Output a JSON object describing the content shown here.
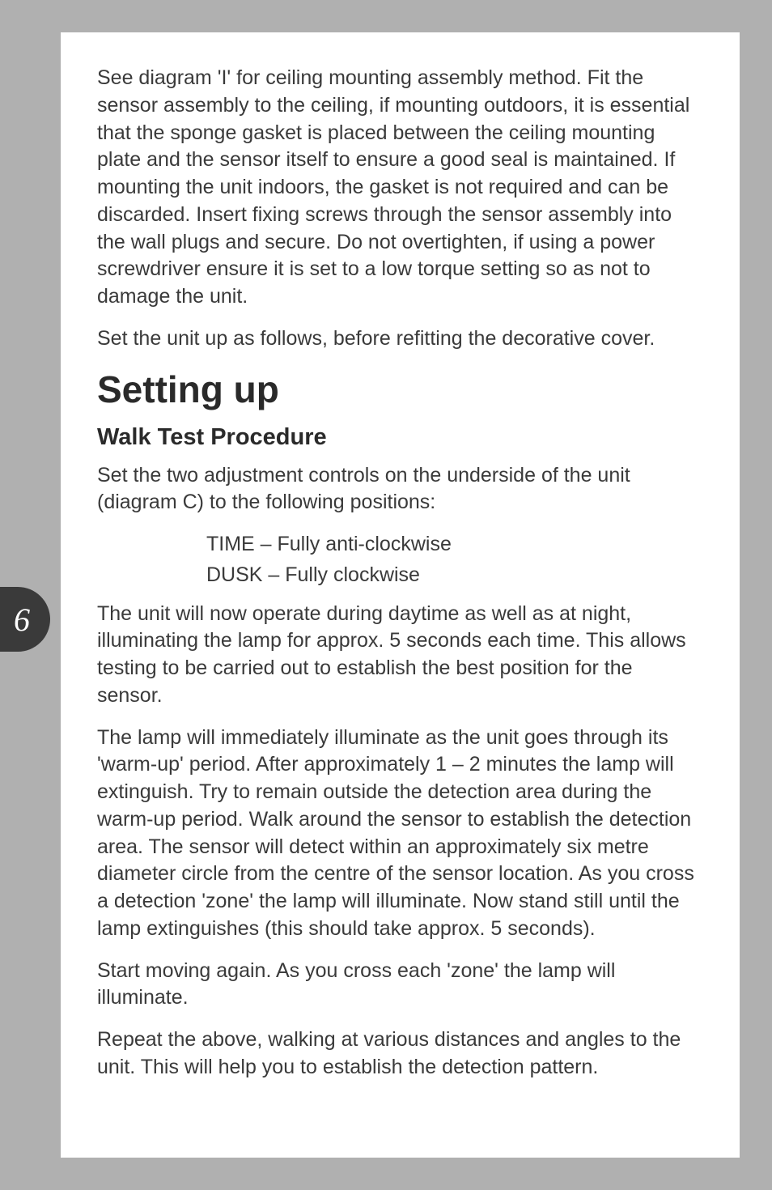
{
  "page_number": "6",
  "p1": "See diagram 'I' for ceiling mounting assembly method. Fit the sensor assembly to the ceiling, if mounting outdoors, it is essential that the sponge gasket is placed between the ceiling mounting plate and the sensor itself to ensure a good seal is maintained. If mounting the unit indoors, the gasket is not required and can be discarded. Insert fixing screws through the sensor assembly into the wall plugs and secure. Do not overtighten, if using a power screwdriver ensure it is set to a low torque setting so as not to damage the unit.",
  "p2": "Set the unit up as follows, before refitting the decorative cover.",
  "h1": "Setting up",
  "h2": "Walk Test Procedure",
  "p3": "Set the two adjustment controls on the underside of the unit (diagram C) to the following positions:",
  "line_time": "TIME – Fully anti-clockwise",
  "line_dusk": "DUSK – Fully clockwise",
  "p4": "The unit will now operate during daytime as well as at night, illuminating the lamp for approx. 5 seconds each time. This allows testing to be carried out to establish the best position for the sensor.",
  "p5": "The lamp will immediately illuminate as the unit goes through its 'warm-up' period. After approximately 1 – 2 minutes the lamp will extinguish. Try to remain outside the detection area during the warm-up period. Walk around the sensor to establish the detection area. The sensor will detect within an approximately six metre diameter circle from the centre of the sensor location. As you cross a detection 'zone' the lamp will illuminate. Now stand still until the lamp extinguishes (this should take approx. 5 seconds).",
  "p6": "Start moving again. As you cross each 'zone' the lamp will illuminate.",
  "p7": "Repeat the above, walking at various distances and angles to the unit. This will help you to establish the detection pattern."
}
